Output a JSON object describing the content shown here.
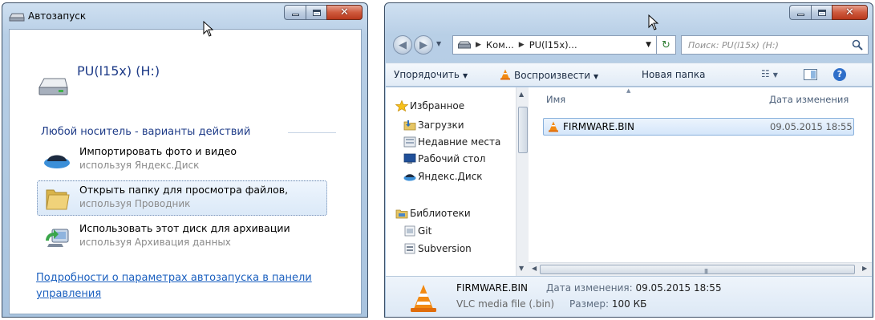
{
  "autoplay": {
    "title": "Автозапуск",
    "drive_name": "PU(l15x) (H:)",
    "section_heading": "Любой носитель - варианты действий",
    "actions": [
      {
        "label": "Импортировать фото и видео",
        "sublabel": "используя Яндекс.Диск",
        "icon": "yandex-disk-icon"
      },
      {
        "label": "Открыть папку для просмотра файлов,",
        "sublabel": "используя Проводник",
        "icon": "folder-icon",
        "selected": true
      },
      {
        "label": "Использовать этот диск для архивации",
        "sublabel": "используя Архивация данных",
        "icon": "backup-icon"
      }
    ],
    "more_link": "Подробности о параметрах автозапуска в панели управления"
  },
  "explorer": {
    "breadcrumb": [
      "Ком...",
      "PU(l15x)..."
    ],
    "search_placeholder": "Поиск: PU(l15x) (H:)",
    "toolbar": {
      "organize": "Упорядочить",
      "play": "Воспроизвести",
      "new_folder": "Новая папка"
    },
    "nav": {
      "favorites_heading": "Избранное",
      "favorites": [
        "Загрузки",
        "Недавние места",
        "Рабочий стол",
        "Яндекс.Диск"
      ],
      "libraries_heading": "Библиотеки",
      "libraries": [
        "Git",
        "Subversion"
      ]
    },
    "columns": {
      "name": "Имя",
      "modified": "Дата изменения"
    },
    "files": [
      {
        "name": "FIRMWARE.BIN",
        "modified": "09.05.2015 18:55"
      }
    ],
    "details": {
      "name": "FIRMWARE.BIN",
      "type": "VLC media file (.bin)",
      "modified_label": "Дата изменения:",
      "modified_value": "09.05.2015 18:55",
      "size_label": "Размер:",
      "size_value": "100 КБ"
    }
  },
  "colors": {
    "link": "#1a5fbf",
    "heading_blue": "#1f3c88",
    "selection_border": "#88b0dc",
    "close_button": "#c8472a"
  }
}
